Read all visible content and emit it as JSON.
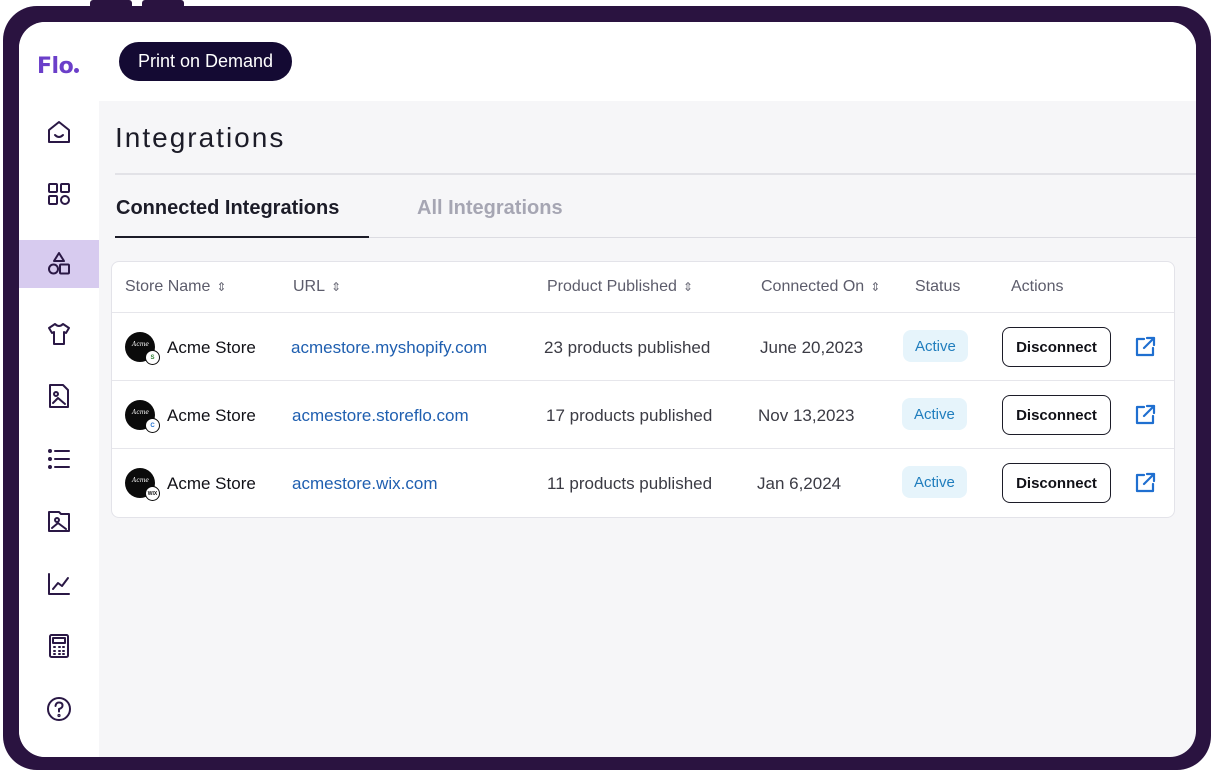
{
  "app": {
    "logo_text": "Flo",
    "topbar": {
      "pill_label": "Print on Demand"
    },
    "nav_icons": [
      "home-icon",
      "grid-icon",
      "shapes-icon",
      "tshirt-icon",
      "image-file-icon",
      "list-icon",
      "gallery-icon",
      "chart-icon",
      "calculator-icon",
      "help-icon"
    ],
    "active_nav": "shapes-icon"
  },
  "page": {
    "title": "Integrations",
    "tabs": [
      {
        "label": "Connected Integrations",
        "active": true
      },
      {
        "label": "All Integrations",
        "active": false
      }
    ]
  },
  "table": {
    "headers": {
      "store_name": "Store Name",
      "url": "URL",
      "product_published": "Product Published",
      "connected_on": "Connected On",
      "status": "Status",
      "actions": "Actions"
    },
    "rows": [
      {
        "store": "Acme Store",
        "url": "acmestore.myshopify.com",
        "published": "23 products published",
        "connected": "June 20,2023",
        "status": "Active",
        "action": "Disconnect",
        "platform_badge": "shopify-badge-icon"
      },
      {
        "store": "Acme Store",
        "url": "acmestore.storeflo.com",
        "published": "17 products published",
        "connected": "Nov 13,2023",
        "status": "Active",
        "action": "Disconnect",
        "platform_badge": "storeflo-badge-icon"
      },
      {
        "store": "Acme Store",
        "url": "acmestore.wix.com",
        "published": "11 products published",
        "connected": "Jan 6,2024",
        "status": "Active",
        "action": "Disconnect",
        "platform_badge": "wix-badge-icon"
      }
    ]
  },
  "colors": {
    "frame": "#2a1340",
    "brand": "#6b3fc9",
    "pill": "#140a33",
    "link": "#1f5fb0",
    "status_bg": "#e6f4fb",
    "status_text": "#1f7dbd"
  }
}
